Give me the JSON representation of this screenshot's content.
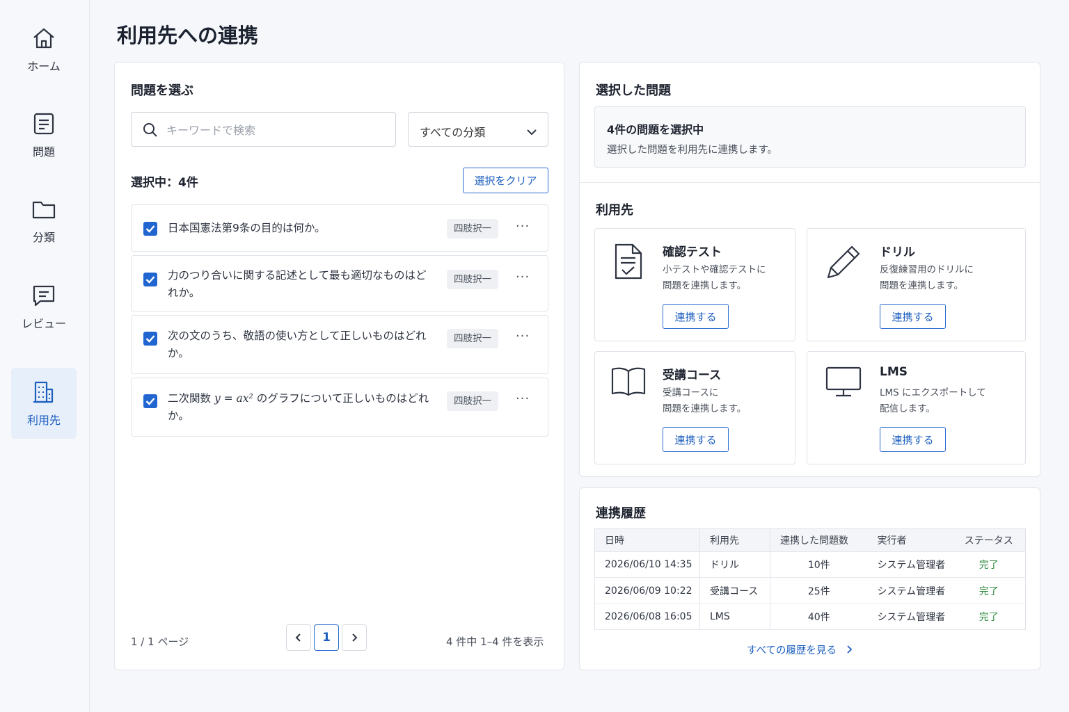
{
  "sidebar": {
    "items": [
      {
        "label": "ホーム",
        "icon": "home-icon"
      },
      {
        "label": "問題",
        "icon": "document-icon"
      },
      {
        "label": "分類",
        "icon": "folder-icon"
      },
      {
        "label": "レビュー",
        "icon": "chat-icon"
      },
      {
        "label": "利用先",
        "icon": "building-icon",
        "active": true
      }
    ]
  },
  "page": {
    "title": "利用先への連携"
  },
  "left_panel": {
    "title": "問題を選ぶ",
    "search_placeholder": "キーワードで検索",
    "category_select": "すべての分類",
    "selected_count": "選択中：4件",
    "clear_button": "選択をクリア",
    "questions": [
      {
        "text": "日本国憲法第9条の目的は何か。",
        "tag": "四肢択一",
        "checked": true
      },
      {
        "text": "力のつり合いに関する記述として最も適切なものはどれか。",
        "tag": "四肢択一",
        "checked": true
      },
      {
        "text": "次の文のうち、敬語の使い方として正しいものはどれか。",
        "tag": "四肢択一",
        "checked": true
      },
      {
        "text_before": "二次関数",
        "formula": "y = ax²",
        "text_after": "のグラフについて正しいものはどれか。",
        "tag": "四肢択一",
        "checked": true
      }
    ],
    "more_label": "···",
    "pagination": {
      "page_info": "1 / 1 ページ",
      "current_page": "1",
      "range_info": "4 件中 1–4 件を表示"
    }
  },
  "selected_panel": {
    "title": "選択した問題",
    "summary_title": "4件の問題を選択中",
    "summary_sub": "選択した問題を利用先に連携します。",
    "targets_title": "利用先",
    "targets": [
      {
        "title": "確認テスト",
        "desc1": "小テストや確認テストに",
        "desc2": "問題を連携します。",
        "button": "連携する",
        "icon": "test-document-icon"
      },
      {
        "title": "ドリル",
        "desc1": "反復練習用のドリルに",
        "desc2": "問題を連携します。",
        "button": "連携する",
        "icon": "pencil-icon"
      },
      {
        "title": "受講コース",
        "desc1": "受講コースに",
        "desc2": "問題を連携します。",
        "button": "連携する",
        "icon": "book-icon"
      },
      {
        "title": "LMS",
        "desc1": "LMS にエクスポートして",
        "desc2": "配信します。",
        "button": "連携する",
        "icon": "monitor-icon"
      }
    ]
  },
  "history_panel": {
    "title": "連携履歴",
    "columns": [
      "日時",
      "利用先",
      "連携した問題数",
      "実行者",
      "ステータス"
    ],
    "rows": [
      {
        "datetime": "2026/06/10 14:35",
        "target": "ドリル",
        "count": "10件",
        "user": "システム管理者",
        "status": "完了"
      },
      {
        "datetime": "2026/06/09 10:22",
        "target": "受講コース",
        "count": "25件",
        "user": "システム管理者",
        "status": "完了"
      },
      {
        "datetime": "2026/06/08 16:05",
        "target": "LMS",
        "count": "40件",
        "user": "システム管理者",
        "status": "完了"
      }
    ],
    "view_all": "すべての履歴を見る"
  },
  "colors": {
    "accent": "#2166d0",
    "success": "#2e8b3e",
    "active_nav_bg": "#e7effa"
  }
}
